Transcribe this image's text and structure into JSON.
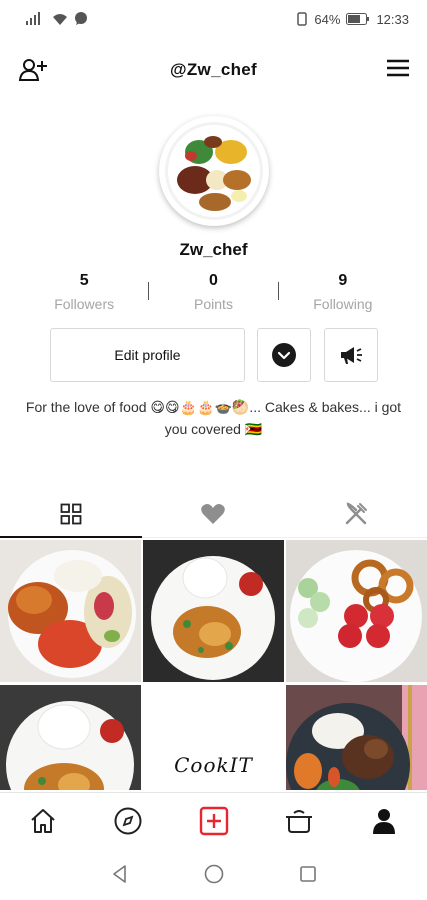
{
  "status_bar": {
    "battery": "64%",
    "time": "12:33"
  },
  "header": {
    "title": "@Zw_chef"
  },
  "profile": {
    "username": "Zw_chef",
    "stats": [
      {
        "value": "5",
        "label": "Followers"
      },
      {
        "value": "0",
        "label": "Points"
      },
      {
        "value": "9",
        "label": "Following"
      }
    ],
    "edit_label": "Edit profile",
    "bio": "For the love of food 😋😋🎂🎂🍲🥙... Cakes & bakes... i got you covered 🇿🇼"
  },
  "tabs": [
    {
      "icon": "grid-icon",
      "active": true
    },
    {
      "icon": "heart-icon",
      "active": false
    },
    {
      "icon": "fork-knife-icon",
      "active": false
    }
  ],
  "posts": [
    {
      "kind": "photo",
      "subject": "chicken, beans and slaw"
    },
    {
      "kind": "photo",
      "subject": "rice with chicken and vegetables"
    },
    {
      "kind": "photo",
      "subject": "onion rings, cucumber and tomato"
    },
    {
      "kind": "photo",
      "subject": "rice with chicken stew"
    },
    {
      "kind": "text",
      "text": "CookIT"
    },
    {
      "kind": "photo",
      "subject": "beef with rice and vegetables"
    }
  ],
  "bottom_nav": [
    "home-icon",
    "compass-icon",
    "add-post-icon",
    "pot-icon",
    "profile-icon"
  ],
  "colors": {
    "accent_red": "#e8262f",
    "muted_text": "#a5a5a5"
  }
}
